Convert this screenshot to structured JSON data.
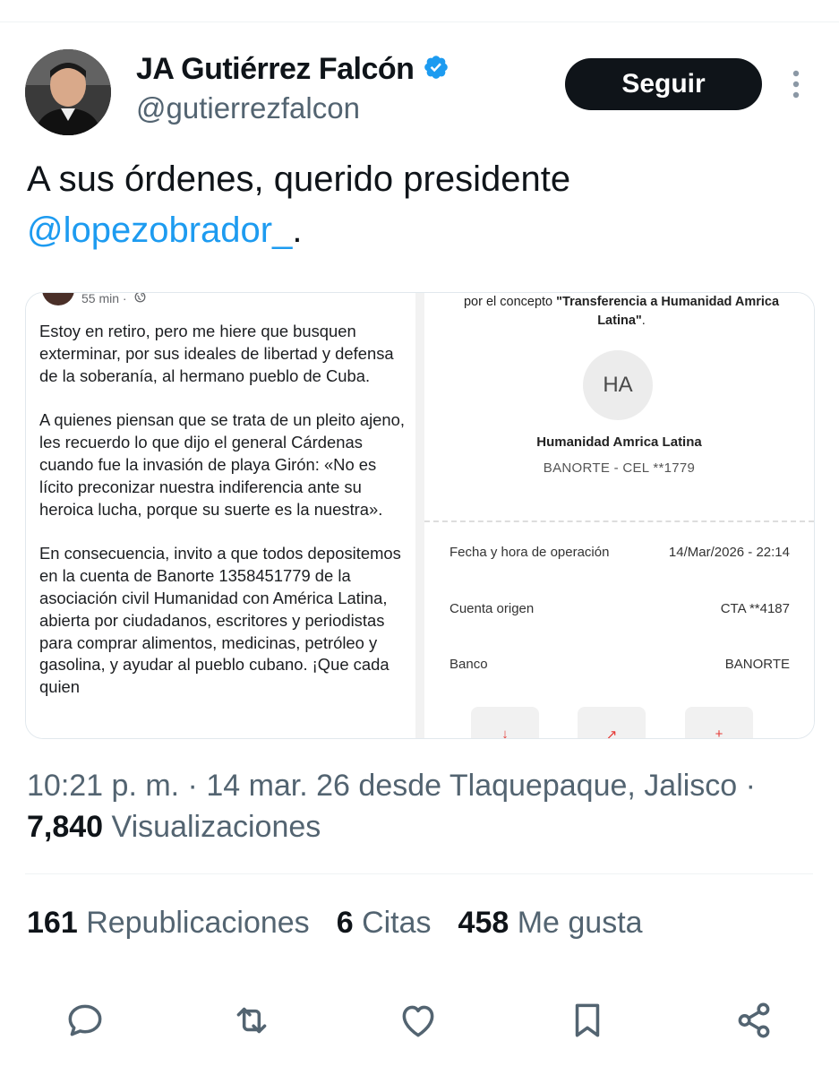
{
  "author": {
    "name": "JA Gutiérrez Falcón",
    "handle": "@gutierrezfalcon",
    "follow_label": "Seguir"
  },
  "tweet": {
    "text_before": "A sus órdenes, querido presidente ",
    "mention": "@lopezobrador_",
    "text_after": "."
  },
  "media": {
    "left": {
      "time": "55 min ·",
      "paragraphs": [
        "Estoy en retiro, pero me hiere que busquen exterminar, por sus ideales de libertad y defensa de la soberanía, al hermano pueblo de Cuba.",
        "A quienes piensan que se trata de un pleito ajeno, les recuerdo lo que dijo el general Cárdenas cuando fue la invasión de playa Girón: «No es lícito preconizar nuestra indiferencia ante su heroica lucha, porque su suerte es la nuestra».",
        "En consecuencia, invito a que todos depositemos en la cuenta de Banorte 1358451779 de la asociación civil Humanidad con América Latina, abierta por ciudadanos, escritores y periodistas para comprar alimentos, medicinas, petróleo y gasolina, y ayudar al pueblo cubano. ¡Que cada quien"
      ]
    },
    "right": {
      "concept_prefix": "por el concepto ",
      "concept_value": "\"Transferencia a Humanidad Amrica Latina\"",
      "concept_suffix": ".",
      "initials": "HA",
      "recipient": "Humanidad Amrica Latina",
      "recipient_sub": "BANORTE - CEL **1779",
      "rows": [
        {
          "label": "Fecha y hora de operación",
          "value": "14/Mar/2026 - 22:14"
        },
        {
          "label": "Cuenta origen",
          "value": "CTA **4187"
        },
        {
          "label": "Banco",
          "value": "BANORTE"
        }
      ]
    }
  },
  "meta": {
    "timestamp": "10:21 p. m. · 14 mar. 26 desde Tlaquepaque, Jalisco ·",
    "views_count": "7,840",
    "views_label": "Visualizaciones"
  },
  "stats": {
    "reposts_count": "161",
    "reposts_label": "Republicaciones",
    "quotes_count": "6",
    "quotes_label": "Citas",
    "likes_count": "458",
    "likes_label": "Me gusta"
  },
  "colors": {
    "accent": "#1d9bf0",
    "secondary_text": "#536471",
    "primary_text": "#0f1419",
    "follow_bg": "#0f1419"
  },
  "icons": [
    "verified-icon",
    "more-icon",
    "reply-icon",
    "repost-icon",
    "like-icon",
    "bookmark-icon",
    "share-icon",
    "globe-icon"
  ]
}
